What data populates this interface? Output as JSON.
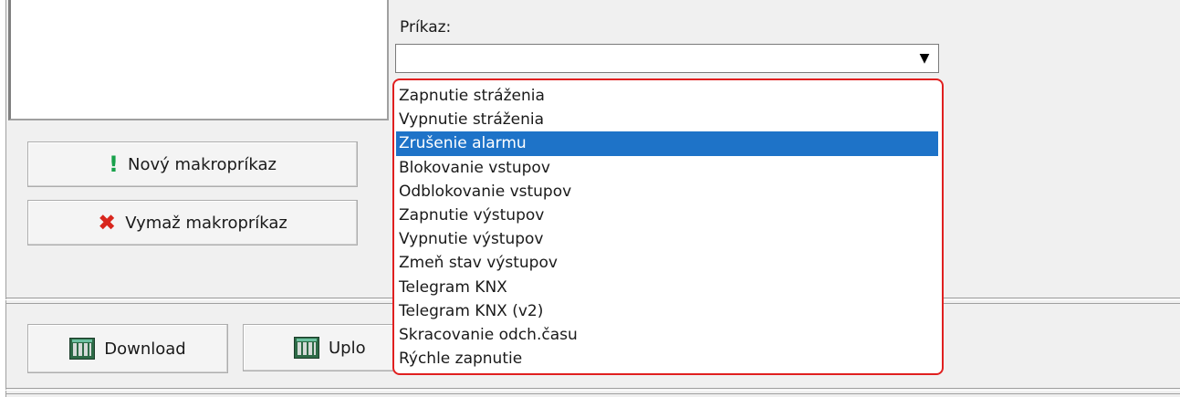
{
  "macro_buttons": {
    "new_label": "Nový makropríkaz",
    "delete_label": "Vymaž makropríkaz",
    "new_icon": "exclamation-icon",
    "delete_icon": "red-x-icon"
  },
  "bottom_buttons": {
    "download_label": "Download",
    "upload_label": "Uplo",
    "icon": "grid-icon"
  },
  "command": {
    "label": "Príkaz:",
    "value": "",
    "dropdown_icon": "chevron-down-icon",
    "options": [
      "Zapnutie stráženia",
      "Vypnutie stráženia",
      "Zrušenie alarmu",
      "Blokovanie vstupov",
      "Odblokovanie vstupov",
      "Zapnutie výstupov",
      "Vypnutie výstupov",
      "Zmeň stav výstupov",
      "Telegram KNX",
      "Telegram KNX (v2)",
      "Skracovanie odch.času",
      "Rýchle zapnutie"
    ],
    "highlighted": "Zrušenie alarmu"
  },
  "colors": {
    "selection": "#1e73c8",
    "highlight_border": "#e02020",
    "window_bg": "#f0f0f0"
  }
}
